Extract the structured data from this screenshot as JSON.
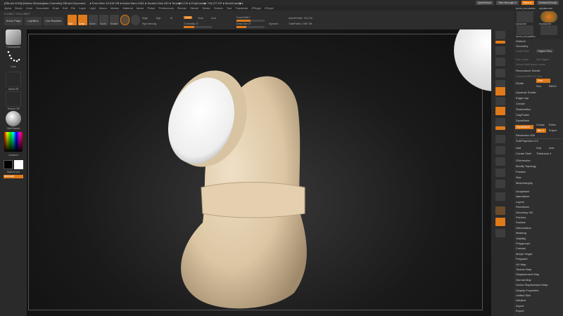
{
  "titlebar": {
    "title": "[ZBrush 2018] [Marina Silvestrglass Cosmetic] ZBrush Document",
    "stats": "● Free Mem 19.018 GB ● Active Mem 1281 ● Scratch Disk 200 ● Timer▶0.176 ● PolyCount▶ 744,277 KP ● MeshCount▶1",
    "quicksave": "QuickSave",
    "see_through": "See-through 0",
    "menus_label": "Menus",
    "default_script": "DefaultZScript"
  },
  "menubar": [
    "Alpha",
    "Brush",
    "Color",
    "Document",
    "Draw",
    "Edit",
    "File",
    "Layer",
    "Light",
    "Macro",
    "Marker",
    "Material",
    "Movie",
    "Picker",
    "Preferences",
    "Render",
    "Stencil",
    "Stroke",
    "Texture",
    "Tool",
    "Transform",
    "ZPlugin",
    "ZScript"
  ],
  "toolbar": {
    "coords": "0.1962,7.701,0.0607",
    "home_page": "Home Page",
    "lightbox": "LightBox",
    "live_boolean": "Live Boolean",
    "edit": "Edit",
    "draw": "Draw",
    "move": "Move",
    "scale": "Scale",
    "rotate": "Rotate",
    "mrgb": "Mrgb",
    "rgb": "Rgb",
    "m": "M",
    "zadd": "Zadd",
    "zsub": "Zsub",
    "zcut": "Zcut",
    "rgb_intensity": "Rgb Intensity",
    "z_intensity": "Z Intensity 37",
    "focal_shift": "Focal Shift 0",
    "focal_shift_value": 0.5,
    "draw_size": "Draw Size 37",
    "draw_size_value": 0.35,
    "dynamic": "Dynamic",
    "active_points": "ActivePoints: 743,716",
    "total_points": "TotalPoints: 4.967 Mil"
  },
  "leftpanel": {
    "brush_label": "TrimAdaptive",
    "stroke_label": "Dots",
    "alpha_label": "Alpha Off",
    "texture_label": "Texture Off",
    "material_label": "SkinShade4",
    "gradient_label": "Gradient",
    "switch_color_label": "SwitchColor",
    "alternate_label": "Alternate"
  },
  "viewport": {
    "footer": "",
    "body_color": "#e6d2b3",
    "cap_color": "#f4f4f4"
  },
  "rightpanel": {
    "top_labels": [
      "Nozzle_InternalWrite",
      "AlphaBrush20",
      "Cylinder3D",
      "PolyMesh3D",
      "Nozzle_InternalWrite"
    ],
    "subtool": "Subtool",
    "geometry": "Geometry",
    "lower_res": "Lower Res",
    "higher_res": "Higher Res",
    "del_lower": "Del Lower",
    "del_higher": "Del Higher",
    "freeze_subdiv": "Freeze SubDivision Levels",
    "reconstruct": "Reconstruct Subdiv",
    "convert_bpr": "Convert BPR To Geo",
    "divide": "Divide",
    "smt": "Smt",
    "suv": "Suv",
    "reuv": "ReUV",
    "dynamic_subdiv": "Dynamic Subdiv",
    "edgeloop": "EdgeLoop",
    "crease": "Crease",
    "shadowbox": "ShadowBox",
    "claypolish": "ClayPolish",
    "dynamesh_header": "DynaMesh",
    "dynamesh_btn": "DynaMesh",
    "groups": "Groups",
    "polish": "Polish",
    "blur": "Blur 2",
    "project": "Project",
    "resolution": "Resolution 408",
    "subprojection": "SubProjection 0.6",
    "add": "Add",
    "sub": "Sub",
    "and": "And",
    "create_shell": "Create Shell",
    "thickness": "Thickness 4",
    "zremesher": "ZRemesher",
    "modify_topology": "Modify Topology",
    "position": "Position",
    "size": "Size",
    "meshintegrity": "MeshIntegrity",
    "sections": [
      "ArrayMesh",
      "NanoMesh",
      "Layers",
      "FiberMesh",
      "Geometry HD",
      "Preview",
      "Surface",
      "Deformation",
      "Masking",
      "Visibility",
      "Polygroups",
      "Contact",
      "Morph Target",
      "Polypaint",
      "UV Map",
      "Texture Map",
      "Displacement Map",
      "Normal Map",
      "Vector Displacement Map",
      "Display Properties",
      "Unified Skin",
      "Initialize",
      "Import",
      "Export"
    ]
  },
  "colors": {
    "accent": "#e07a1a",
    "panel": "#2f2f2f",
    "background": "#1e1e1e"
  }
}
